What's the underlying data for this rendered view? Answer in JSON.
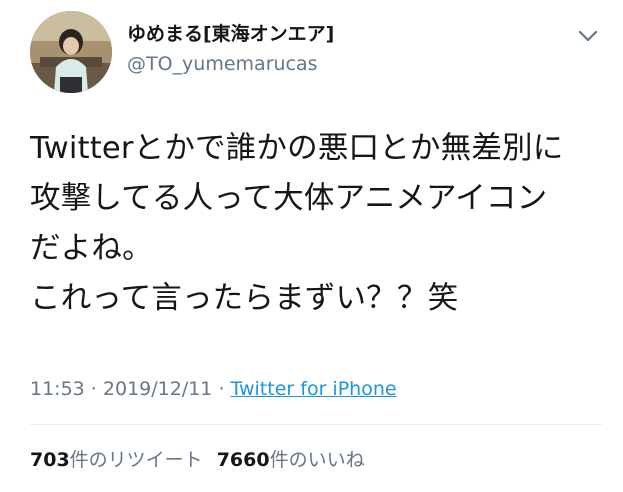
{
  "user": {
    "display_name": "ゆめまる[東海オンエア]",
    "handle": "@TO_yumemarucas",
    "avatar_icon": "user-avatar-photo"
  },
  "header": {
    "menu_icon": "chevron-down-icon"
  },
  "tweet": {
    "lines": [
      "Twitterとかで誰かの悪口とか無差別に",
      "攻撃してる人って大体アニメアイコン",
      "だよね。",
      "これって言ったらまずい？？笑"
    ]
  },
  "meta": {
    "time": "11:53",
    "sep1": " · ",
    "date": "2019/12/11",
    "sep2": " · ",
    "source": "Twitter for iPhone"
  },
  "stats": {
    "retweet_count": "703",
    "retweet_label": "件のリツイート",
    "like_count": "7660",
    "like_label": "件のいいね"
  },
  "colors": {
    "text_primary": "#14171a",
    "text_secondary": "#657786",
    "link": "#1b95e0",
    "divider": "#e6ecf0"
  }
}
